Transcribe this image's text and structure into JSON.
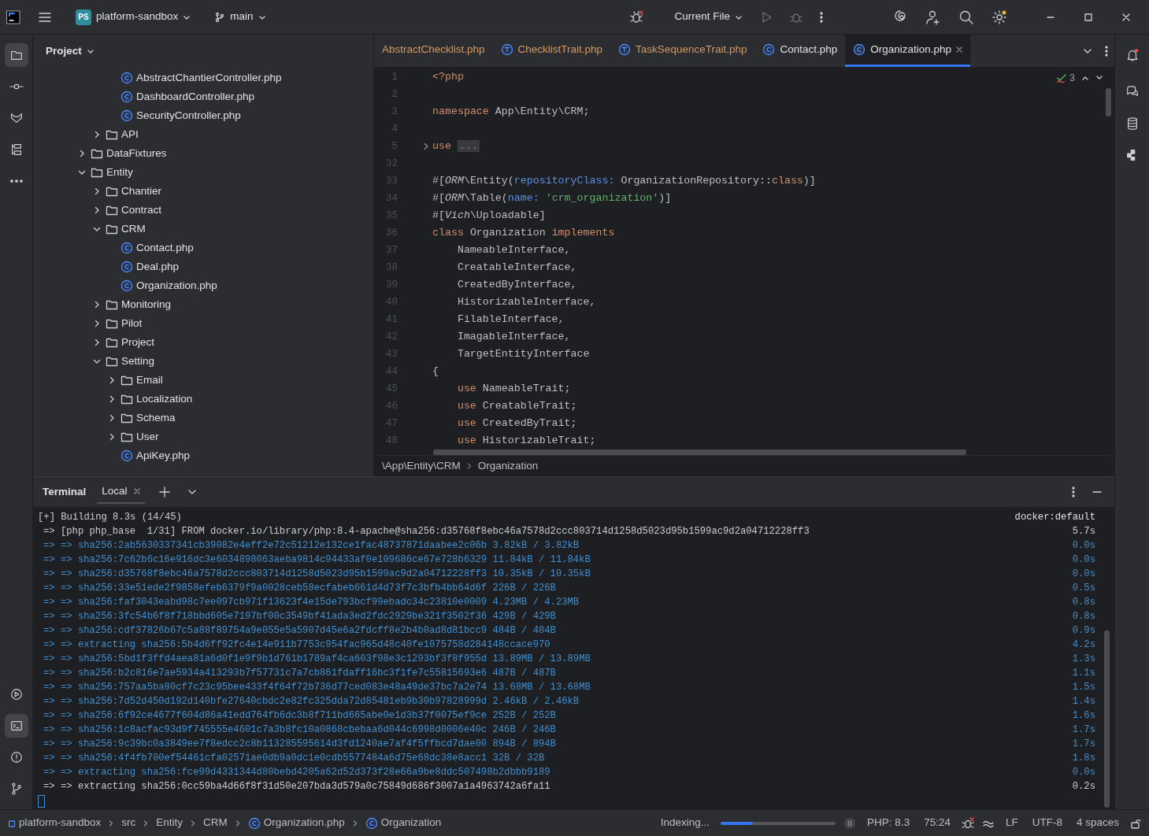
{
  "title_bar": {
    "project": {
      "badge": "PS",
      "name": "platform-sandbox"
    },
    "branch": "main",
    "run_config": "Current File"
  },
  "left_toolbar": {
    "top": [
      {
        "kind": "folder",
        "selected": true
      },
      {
        "kind": "commit",
        "selected": false
      },
      {
        "kind": "fox",
        "selected": false
      },
      {
        "kind": "structure",
        "selected": false
      },
      {
        "kind": "more",
        "selected": false
      }
    ],
    "bottom": [
      {
        "kind": "services",
        "selected": false
      },
      {
        "kind": "terminal",
        "selected": true
      },
      {
        "kind": "problems",
        "selected": false
      },
      {
        "kind": "git",
        "selected": false
      }
    ]
  },
  "project_panel": {
    "title": "Project",
    "tree": [
      {
        "children": [
          {
            "children": [
              {
                "label": "AbstractChantierController.php",
                "kind": "class"
              },
              {
                "label": "DashboardController.php",
                "kind": "class"
              },
              {
                "label": "SecurityController.php",
                "kind": "class"
              }
            ]
          },
          {
            "label": "API",
            "kind": "folder",
            "expanded": false
          }
        ]
      },
      {
        "label": "DataFixtures",
        "kind": "folder",
        "expanded": false
      },
      {
        "label": "Entity",
        "kind": "folder",
        "expanded": true,
        "children": [
          {
            "label": "Chantier",
            "kind": "folder",
            "expanded": false
          },
          {
            "label": "Contract",
            "kind": "folder",
            "expanded": false
          },
          {
            "label": "CRM",
            "kind": "folder",
            "expanded": true,
            "children": [
              {
                "label": "Contact.php",
                "kind": "class"
              },
              {
                "label": "Deal.php",
                "kind": "class"
              },
              {
                "label": "Organization.php",
                "kind": "class"
              }
            ]
          },
          {
            "label": "Monitoring",
            "kind": "folder",
            "expanded": false
          },
          {
            "label": "Pilot",
            "kind": "folder",
            "expanded": false
          },
          {
            "label": "Project",
            "kind": "folder",
            "expanded": false
          },
          {
            "label": "Setting",
            "kind": "folder",
            "expanded": true,
            "children": [
              {
                "label": "Email",
                "kind": "folder",
                "expanded": false
              },
              {
                "label": "Localization",
                "kind": "folder",
                "expanded": false
              },
              {
                "label": "Schema",
                "kind": "folder",
                "expanded": false
              },
              {
                "label": "User",
                "kind": "folder",
                "expanded": false
              },
              {
                "label": "ApiKey.php",
                "kind": "class"
              }
            ]
          }
        ]
      }
    ]
  },
  "editor_tabs": [
    {
      "label": "AbstractChecklist.php",
      "kind": "plain",
      "has_errors": true,
      "selected": false
    },
    {
      "label": "ChecklistTrait.php",
      "kind": "trait",
      "has_errors": true,
      "selected": false
    },
    {
      "label": "TaskSequenceTrait.php",
      "kind": "trait",
      "has_errors": true,
      "selected": false
    },
    {
      "label": "Contact.php",
      "kind": "class",
      "has_errors": false,
      "selected": false
    },
    {
      "label": "Organization.php",
      "kind": "class",
      "has_errors": false,
      "selected": true
    }
  ],
  "editor": {
    "inspections": "3",
    "lines": [
      {
        "num": "1",
        "tokens": [
          {
            "t": "<?php",
            "kind": "keyword"
          }
        ]
      },
      {
        "num": "2"
      },
      {
        "num": "3",
        "tokens": [
          {
            "t": "namespace ",
            "kind": "keyword"
          },
          {
            "t": "App\\Entity\\CRM;",
            "kind": "plain"
          }
        ]
      },
      {
        "num": "4"
      },
      {
        "num": "5",
        "folded": true,
        "tokens": [
          {
            "t": "use ",
            "kind": "keyword"
          },
          {
            "t": "...",
            "kind": "fold"
          }
        ]
      },
      {
        "num": "32"
      },
      {
        "num": "33",
        "tokens": [
          {
            "t": "#[",
            "kind": "plain"
          },
          {
            "t": "ORM",
            "kind": "attribute"
          },
          {
            "t": "\\Entity(",
            "kind": "plain"
          },
          {
            "t": "repositoryClass: ",
            "kind": "named"
          },
          {
            "t": "OrganizationRepository::",
            "kind": "plain"
          },
          {
            "t": "class",
            "kind": "keyword"
          },
          {
            "t": ")]",
            "kind": "plain"
          }
        ]
      },
      {
        "num": "34",
        "tokens": [
          {
            "t": "#[",
            "kind": "plain"
          },
          {
            "t": "ORM",
            "kind": "attribute"
          },
          {
            "t": "\\Table(",
            "kind": "plain"
          },
          {
            "t": "name: ",
            "kind": "named"
          },
          {
            "t": "'crm_organization'",
            "kind": "string"
          },
          {
            "t": ")]",
            "kind": "plain"
          }
        ]
      },
      {
        "num": "35",
        "tokens": [
          {
            "t": "#[",
            "kind": "plain"
          },
          {
            "t": "Vich",
            "kind": "attribute"
          },
          {
            "t": "\\Uploadable]",
            "kind": "plain"
          }
        ]
      },
      {
        "num": "36",
        "tokens": [
          {
            "t": "class ",
            "kind": "keyword"
          },
          {
            "t": "Organization ",
            "kind": "plain"
          },
          {
            "t": "implements",
            "kind": "keyword"
          }
        ]
      },
      {
        "num": "37",
        "indented": true,
        "tokens": [
          {
            "t": "NameableInterface,",
            "kind": "plain"
          }
        ]
      },
      {
        "num": "38",
        "indented": true,
        "tokens": [
          {
            "t": "CreatableInterface,",
            "kind": "plain"
          }
        ]
      },
      {
        "num": "39",
        "indented": true,
        "tokens": [
          {
            "t": "CreatedByInterface,",
            "kind": "plain"
          }
        ]
      },
      {
        "num": "40",
        "indented": true,
        "tokens": [
          {
            "t": "HistorizableInterface,",
            "kind": "plain"
          }
        ]
      },
      {
        "num": "41",
        "indented": true,
        "tokens": [
          {
            "t": "FilableInterface,",
            "kind": "plain"
          }
        ]
      },
      {
        "num": "42",
        "indented": true,
        "tokens": [
          {
            "t": "ImagableInterface,",
            "kind": "plain"
          }
        ]
      },
      {
        "num": "43",
        "indented": true,
        "tokens": [
          {
            "t": "TargetEntityInterface",
            "kind": "plain"
          }
        ]
      },
      {
        "num": "44",
        "tokens": [
          {
            "t": "{",
            "kind": "plain"
          }
        ]
      },
      {
        "num": "45",
        "indented": true,
        "tokens": [
          {
            "t": "use ",
            "kind": "keyword"
          },
          {
            "t": "NameableTrait;",
            "kind": "plain"
          }
        ]
      },
      {
        "num": "46",
        "indented": true,
        "tokens": [
          {
            "t": "use ",
            "kind": "keyword"
          },
          {
            "t": "CreatableTrait;",
            "kind": "plain"
          }
        ]
      },
      {
        "num": "47",
        "indented": true,
        "tokens": [
          {
            "t": "use ",
            "kind": "keyword"
          },
          {
            "t": "CreatedByTrait;",
            "kind": "plain"
          }
        ]
      },
      {
        "num": "48",
        "indented": true,
        "tokens": [
          {
            "t": "use ",
            "kind": "keyword"
          },
          {
            "t": "HistorizableTrait;",
            "kind": "plain"
          }
        ]
      }
    ],
    "breadcrumb": [
      "\\App\\Entity\\CRM",
      "Organization"
    ]
  },
  "terminal": {
    "title": "Terminal",
    "tabs": [
      {
        "label": "Local",
        "selected": true
      }
    ],
    "target": "docker:default",
    "lines": [
      {
        "kind": "header",
        "text": "[+] Building 8.3s (14/45)"
      },
      {
        "kind": "step",
        "text": "=> [php php_base  1/31] FROM docker.io/library/php:8.4-apache@sha256:d35768f8ebc46a7578d2ccc803714d1258d5023d95b1599ac9d2a04712228ff3",
        "time": "5.7s"
      },
      {
        "kind": "sub",
        "text": "=> => sha256:2ab5630337341cb39082e4eff2e72c51212e132ce1fac48737871daabee2c06b 3.82kB / 3.82kB",
        "time": "0.0s"
      },
      {
        "kind": "sub",
        "text": "=> => sha256:7c62b6c16e916dc3e6034898063aeba9814c94433af0e109686ce67e728b6329 11.84kB / 11.84kB",
        "time": "0.0s"
      },
      {
        "kind": "sub",
        "text": "=> => sha256:d35768f8ebc46a7578d2ccc803714d1258d5023d95b1599ac9d2a04712228ff3 10.35kB / 10.35kB",
        "time": "0.0s"
      },
      {
        "kind": "sub",
        "text": "=> => sha256:33e51ede2f9858efeb6379f9a0028ceb58ecfabeb661d4d73f7c3bfb4bb64d6f 226B / 226B",
        "time": "0.5s"
      },
      {
        "kind": "sub",
        "text": "=> => sha256:faf3043eabd98c7ee097cb971f13623f4e15de793bcf99ebadc34c23810e0009 4.23MB / 4.23MB",
        "time": "0.8s"
      },
      {
        "kind": "sub",
        "text": "=> => sha256:3fc54b6f8f718bbd605e7197bf00c3549bf41ada3ed2fdc2929be321f3502f36 429B / 429B",
        "time": "0.8s"
      },
      {
        "kind": "sub",
        "text": "=> => sha256:cdf37826b67c5a88f89754a9e055e5a5907d45e6a2fdcff8e2b4b0ad8d81bcc9 484B / 484B",
        "time": "0.9s"
      },
      {
        "kind": "sub",
        "text": "=> => extracting sha256:5b4d6ff92fc4e14e911b7753c954fac965d48c40fe1075758d284148ccace970",
        "time": "4.2s"
      },
      {
        "kind": "sub",
        "text": "=> => sha256:5bd1f3ffd4aea81a6d0f1e9f9b1d761b1789af4ca603f98e3c1293bf3f8f955d 13.89MB / 13.89MB",
        "time": "1.3s"
      },
      {
        "kind": "sub",
        "text": "=> => sha256:b2c816e7ae5934a413293b7f57731c7a7cb861fdaff16bc3f1fe7c55815693e6 487B / 487B",
        "time": "1.1s"
      },
      {
        "kind": "sub",
        "text": "=> => sha256:757aa5ba80cf7c23c95bee433f4f64f72b736d77ced083e48a49de37bc7a2e74 13.68MB / 13.68MB",
        "time": "1.5s"
      },
      {
        "kind": "sub",
        "text": "=> => sha256:7d52d450d192d140bfe27640cbdc2e82fc325dda72d85481eb9b30b97828999d 2.46kB / 2.46kB",
        "time": "1.4s"
      },
      {
        "kind": "sub",
        "text": "=> => sha256:6f92ce4677f604d86a41edd764fb6dc3b8f711bd665abe0e1d3b37f0075ef9ce 252B / 252B",
        "time": "1.6s"
      },
      {
        "kind": "sub",
        "text": "=> => sha256:1c8acfac93d9f745555e4601c7a3b8fc10a0868cbebaa6d044c6998d0006e40c 246B / 246B",
        "time": "1.7s"
      },
      {
        "kind": "sub",
        "text": "=> => sha256:9c39bc0a3849ee7f8edcc2c8b113285595614d3fd1240ae7af4f5ffbcd7dae00 894B / 894B",
        "time": "1.7s"
      },
      {
        "kind": "sub",
        "text": "=> => sha256:4f4fb700ef54461cfa02571ae0db9a0dc1e0cdb5577484a6d75e68dc38e8acc1 32B / 32B",
        "time": "1.8s"
      },
      {
        "kind": "sub",
        "text": "=> => extracting sha256:fce99d4331344d80bebd4205a62d52d373f28e66a9be8ddc507498b2dbbb9189",
        "time": "0.0s"
      },
      {
        "kind": "active",
        "text": "=> => extracting sha256:0cc59ba4d66f8f31d50e207bda3d579a0c75849d686f3007a1a4963742a6fa11",
        "time": "0.2s"
      }
    ]
  },
  "status_bar": {
    "breadcrumb": [
      {
        "label": "platform-sandbox",
        "kind": "module"
      },
      {
        "label": "src",
        "kind": "folder"
      },
      {
        "label": "Entity",
        "kind": "folder"
      },
      {
        "label": "CRM",
        "kind": "folder"
      },
      {
        "label": "Organization.php",
        "kind": "class"
      },
      {
        "label": "Organization",
        "kind": "class"
      }
    ],
    "task": "Indexing...",
    "progress": {
      "level": 0.28
    },
    "php": "PHP: 8.3",
    "position": "75:24",
    "line_ending": "LF",
    "encoding": "UTF-8",
    "indent": "4 spaces"
  }
}
